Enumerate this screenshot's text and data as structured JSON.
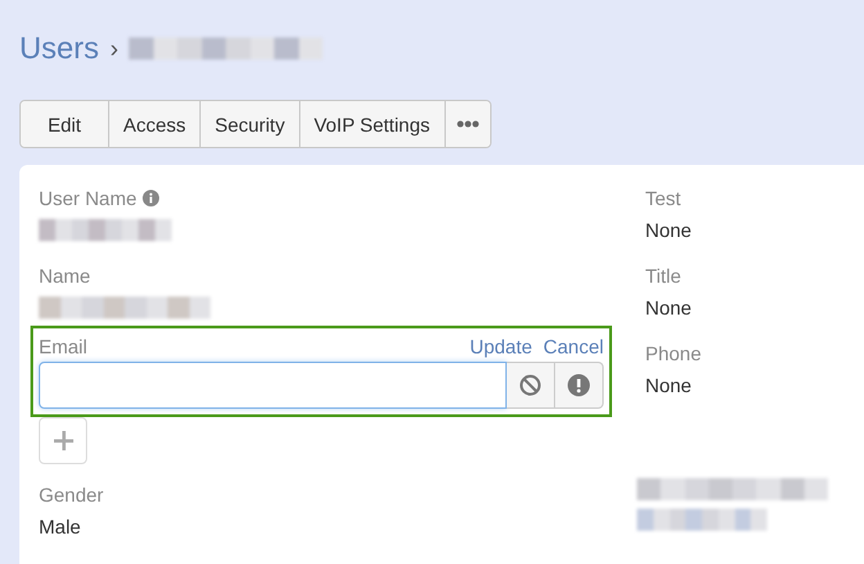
{
  "breadcrumb": {
    "root": "Users",
    "separator": "›"
  },
  "toolbar": [
    {
      "label": "Edit"
    },
    {
      "label": "Access"
    },
    {
      "label": "Security"
    },
    {
      "label": "VoIP Settings"
    }
  ],
  "left_fields": [
    {
      "kind": "text",
      "label": "User Name",
      "info_icon": true
    },
    {
      "kind": "text",
      "label": "Name",
      "info_icon": false
    },
    {
      "kind": "edit",
      "label": "Email",
      "actions": [
        "Update",
        "Cancel"
      ]
    },
    {
      "kind": "text",
      "label": "Gender",
      "info_icon": false,
      "value": "Male"
    }
  ],
  "right_fields": [
    {
      "kind": "text",
      "label": "Test",
      "value": "None"
    },
    {
      "kind": "text",
      "label": "Title",
      "value": "None"
    },
    {
      "kind": "text",
      "label": "Phone",
      "value": "None"
    },
    {
      "kind": "redacted"
    }
  ]
}
